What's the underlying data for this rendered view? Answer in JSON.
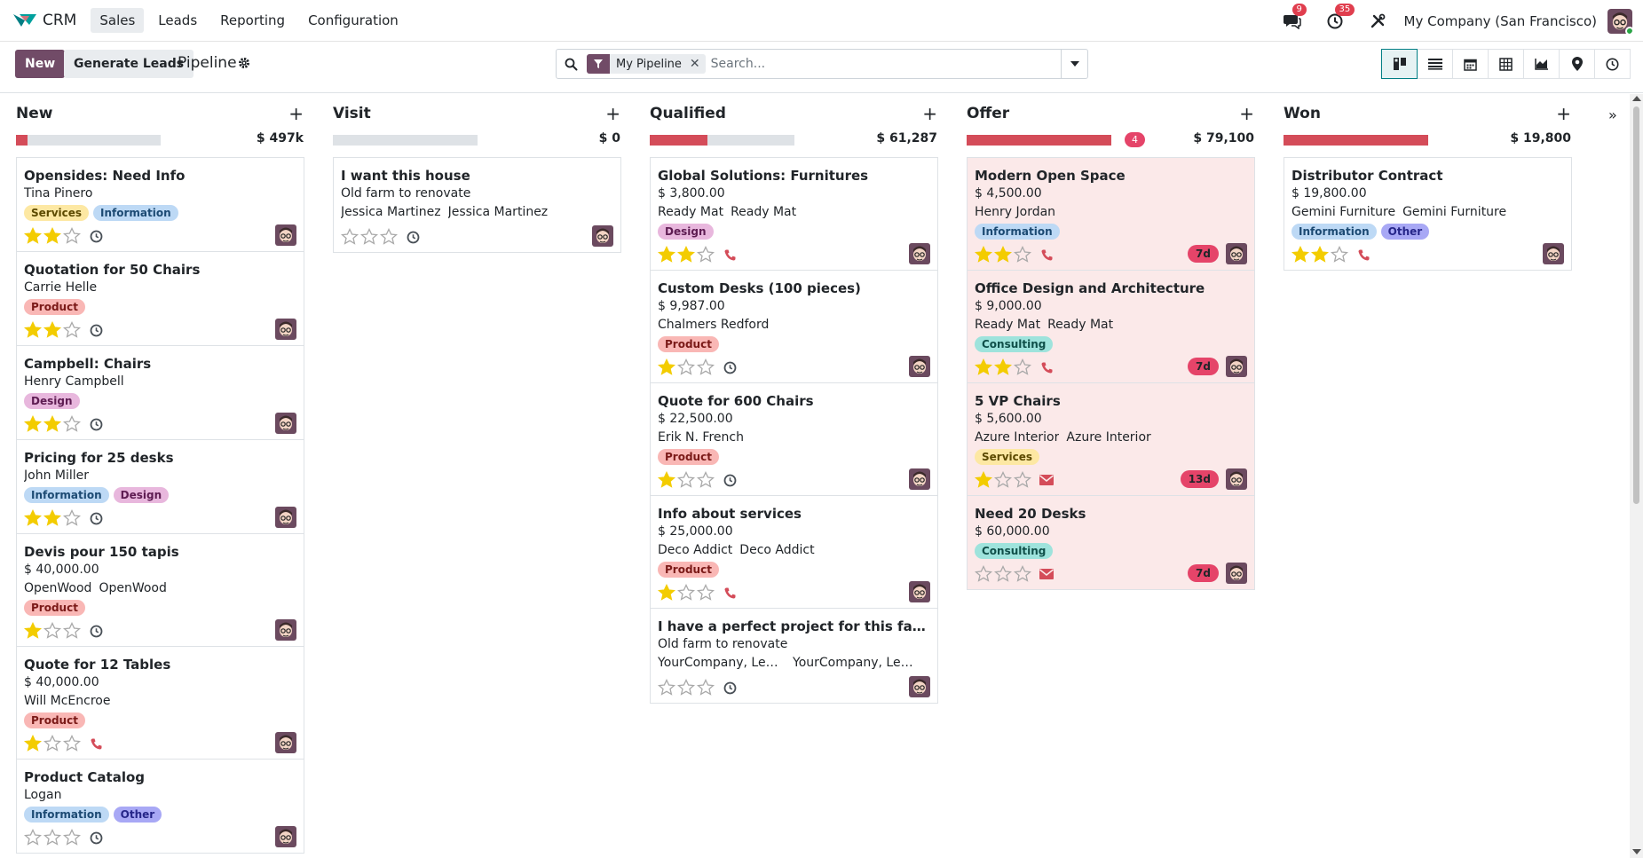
{
  "app": {
    "name": "CRM",
    "menu": [
      "Sales",
      "Leads",
      "Reporting",
      "Configuration"
    ],
    "active_menu": "Sales",
    "messages_badge": "9",
    "activities_badge": "35",
    "company": "My Company (San Francisco)"
  },
  "control": {
    "new_label": "New",
    "generate_label": "Generate Leads",
    "title": "Pipeline",
    "search_facet": "My Pipeline",
    "search_placeholder": "Search..."
  },
  "views": [
    "kanban",
    "list",
    "calendar",
    "pivot",
    "graph",
    "map",
    "activity"
  ],
  "active_view": "kanban",
  "colors": {
    "primary": "#714b67",
    "accent": "#017e84",
    "danger": "#d44c59",
    "overdue": "#e54469",
    "card_overdue_bg": "#fbe9e9",
    "star": "#f3cc00"
  },
  "stages": [
    {
      "name": "New",
      "total": "$ 497k",
      "progress": 0.08,
      "count_badge": "",
      "cards": [
        {
          "title": "Opensides: Need Info",
          "lines": [
            "Tina Pinero"
          ],
          "partners": [],
          "tags": [
            "Services",
            "Information"
          ],
          "stars": 2,
          "activity": "clock",
          "days": ""
        },
        {
          "title": "Quotation for 50 Chairs",
          "lines": [
            "Carrie Helle"
          ],
          "partners": [],
          "tags": [
            "Product"
          ],
          "stars": 2,
          "activity": "clock",
          "days": ""
        },
        {
          "title": "Campbell: Chairs",
          "lines": [
            "Henry Campbell"
          ],
          "partners": [],
          "tags": [
            "Design"
          ],
          "stars": 2,
          "activity": "clock",
          "days": ""
        },
        {
          "title": "Pricing for 25 desks",
          "lines": [
            "John Miller"
          ],
          "partners": [],
          "tags": [
            "Information",
            "Design"
          ],
          "stars": 2,
          "activity": "clock",
          "days": ""
        },
        {
          "title": "Devis pour 150 tapis",
          "lines": [
            "$ 40,000.00"
          ],
          "partners": [
            "OpenWood",
            "OpenWood"
          ],
          "tags": [
            "Product"
          ],
          "stars": 1,
          "activity": "clock",
          "days": ""
        },
        {
          "title": "Quote for 12 Tables",
          "lines": [
            "$ 40,000.00",
            "Will McEncroe"
          ],
          "partners": [],
          "tags": [
            "Product"
          ],
          "stars": 1,
          "activity": "phone",
          "days": ""
        },
        {
          "title": "Product Catalog",
          "lines": [
            "Logan"
          ],
          "partners": [],
          "tags": [
            "Information",
            "Other"
          ],
          "stars": 0,
          "activity": "clock",
          "days": ""
        }
      ]
    },
    {
      "name": "Visit",
      "total": "$ 0",
      "progress": 0,
      "count_badge": "",
      "cards": [
        {
          "title": "I want this house",
          "lines": [
            "Old farm to renovate"
          ],
          "partners": [
            "Jessica Martinez",
            "Jessica Martinez"
          ],
          "tags": [],
          "stars": 0,
          "activity": "clock",
          "days": ""
        }
      ]
    },
    {
      "name": "Qualified",
      "total": "$ 61,287",
      "progress": 0.4,
      "count_badge": "",
      "cards": [
        {
          "title": "Global Solutions: Furnitures",
          "lines": [
            "$ 3,800.00"
          ],
          "partners": [
            "Ready Mat",
            "Ready Mat"
          ],
          "tags": [
            "Design"
          ],
          "stars": 2,
          "activity": "phone",
          "days": ""
        },
        {
          "title": "Custom Desks (100 pieces)",
          "lines": [
            "$ 9,987.00",
            "Chalmers Redford"
          ],
          "partners": [],
          "tags": [
            "Product"
          ],
          "stars": 1,
          "activity": "clock",
          "days": ""
        },
        {
          "title": "Quote for 600 Chairs",
          "lines": [
            "$ 22,500.00",
            "Erik N. French"
          ],
          "partners": [],
          "tags": [
            "Product"
          ],
          "stars": 1,
          "activity": "clock",
          "days": ""
        },
        {
          "title": "Info about services",
          "lines": [
            "$ 25,000.00"
          ],
          "partners": [
            "Deco Addict",
            "Deco Addict"
          ],
          "tags": [
            "Product"
          ],
          "stars": 1,
          "activity": "phone",
          "days": ""
        },
        {
          "title": "I have a perfect project for this farm",
          "lines": [
            "Old farm to renovate"
          ],
          "partners": [
            "YourCompany, Lee Parker",
            "YourCompany, Lee Parker"
          ],
          "tags": [],
          "stars": 0,
          "activity": "clock",
          "days": ""
        }
      ]
    },
    {
      "name": "Offer",
      "total": "$ 79,100",
      "progress": 1,
      "count_badge": "4",
      "cards": [
        {
          "title": "Modern Open Space",
          "lines": [
            "$ 4,500.00",
            "Henry Jordan"
          ],
          "partners": [],
          "tags": [
            "Information"
          ],
          "stars": 2,
          "activity": "phone",
          "days": "7d"
        },
        {
          "title": "Office Design and Architecture",
          "lines": [
            "$ 9,000.00"
          ],
          "partners": [
            "Ready Mat",
            "Ready Mat"
          ],
          "tags": [
            "Consulting"
          ],
          "stars": 2,
          "activity": "phone",
          "days": "7d"
        },
        {
          "title": "5 VP Chairs",
          "lines": [
            "$ 5,600.00"
          ],
          "partners": [
            "Azure Interior",
            "Azure Interior"
          ],
          "tags": [
            "Services"
          ],
          "stars": 1,
          "activity": "mail",
          "days": "13d"
        },
        {
          "title": "Need 20 Desks",
          "lines": [
            "$ 60,000.00"
          ],
          "partners": [],
          "tags": [
            "Consulting"
          ],
          "stars": 0,
          "activity": "mail",
          "days": "7d"
        }
      ]
    },
    {
      "name": "Won",
      "total": "$ 19,800",
      "progress": 1,
      "count_badge": "",
      "cards": [
        {
          "title": "Distributor Contract",
          "lines": [
            "$ 19,800.00"
          ],
          "partners": [
            "Gemini Furniture",
            "Gemini Furniture"
          ],
          "tags": [
            "Information",
            "Other"
          ],
          "stars": 2,
          "activity": "phone",
          "days": ""
        }
      ]
    }
  ]
}
